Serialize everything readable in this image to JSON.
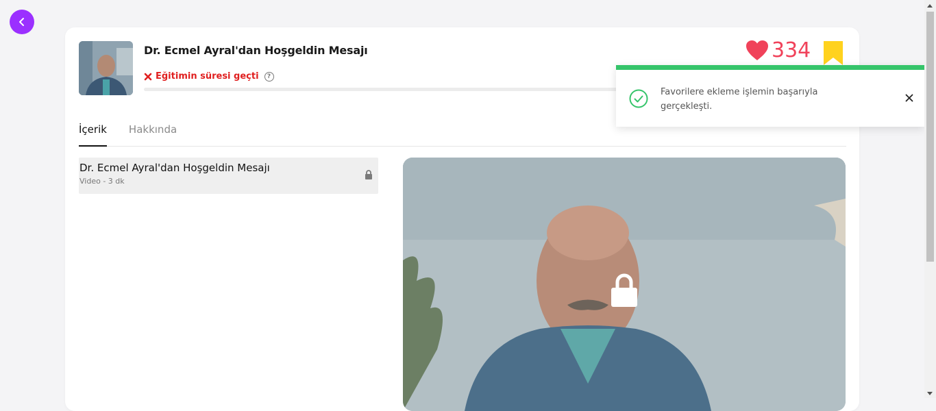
{
  "header": {
    "title": "Dr. Ecmel Ayral'dan Hoşgeldin Mesajı",
    "status_text": "Eğitimin süresi geçti",
    "help_glyph": "?",
    "like_count": "334",
    "colors": {
      "accent": "#9b30ff",
      "like": "#f0425a",
      "bookmark": "#ffd21e",
      "error": "#e02020",
      "success": "#35c46a"
    }
  },
  "tabs": [
    {
      "label": "İçerik",
      "active": true
    },
    {
      "label": "Hakkında",
      "active": false
    }
  ],
  "lessons": [
    {
      "title": "Dr. Ecmel Ayral'dan Hoşgeldin Mesajı",
      "meta": "Video - 3 dk",
      "locked": true
    }
  ],
  "toast": {
    "message": "Favorilere ekleme işlemin başarıyla gerçekleşti.",
    "type": "success"
  },
  "icons": [
    "back-icon",
    "heart-icon",
    "bookmark-icon",
    "close-x-icon",
    "help-icon",
    "lock-icon",
    "check-circle-icon",
    "close-icon"
  ]
}
